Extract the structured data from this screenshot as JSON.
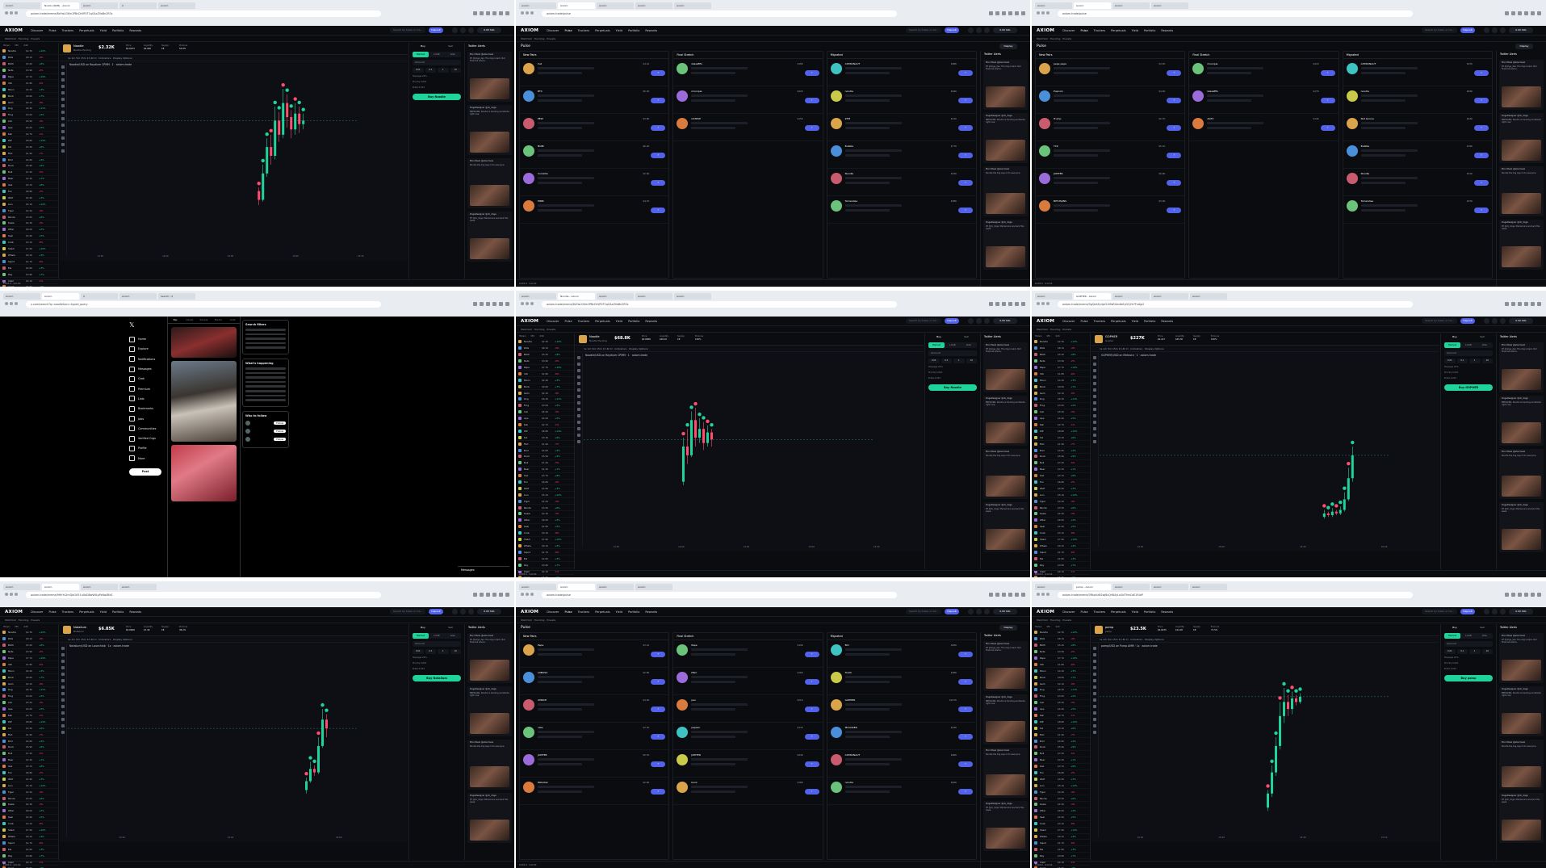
{
  "panels": [
    {
      "kind": "trade",
      "tabs": [
        "Axiom",
        "Nostlu (NUB) - Axiom",
        "Axiom",
        "X",
        "Axiom"
      ],
      "url": "axiom.trade/meme/8zYwLGKm1PBcDrVR5T1qGAxZVoBn2R3c",
      "nav": [
        "Discover",
        "Pulse",
        "Trackers",
        "Perpetuals",
        "Yield",
        "Portfolio",
        "Rewards"
      ],
      "coin": {
        "name": "Noodle",
        "sub": "Noodle the Dog",
        "price": "$2.32K"
      },
      "stats": [
        [
          "Price",
          "$0.0233"
        ],
        [
          "Liquidity",
          "$9.92K"
        ],
        [
          "Supply",
          "1B"
        ],
        [
          "B.Curve",
          "54.9%"
        ]
      ],
      "chart_title": "Noodle/USD on Raydium CPMM · 1 · axiom.trade",
      "times": [
        "13:30",
        "14:00",
        "14:30",
        "15:00",
        "15:30"
      ],
      "buy_label": "Buy Noodle",
      "footer": {
        "sol": "$158.9",
        "btc": "$113K"
      }
    },
    {
      "kind": "pulse",
      "tabs": [
        "Axiom",
        "Axiom",
        "Axiom",
        "Axiom",
        "Axiom"
      ],
      "url": "axiom.trade/pulse",
      "nav": [
        "Discover",
        "Pulse",
        "Trackers",
        "Perpetuals",
        "Yield",
        "Portfolio",
        "Rewards"
      ],
      "columns": [
        "New Pairs",
        "Final Stretch",
        "Migrated"
      ],
      "cards": [
        [
          [
            "Cat",
            "$4.1K"
          ],
          [
            "BTC",
            "$5.3K"
          ],
          [
            "PEW",
            "$3.8K"
          ],
          [
            "NOBI",
            "$6.2K"
          ],
          [
            "Coinzilla",
            "$2.9K"
          ],
          [
            "MNM",
            "$4.7K"
          ]
        ],
        [
          [
            "GlassEEs",
            "$18K"
          ],
          [
            "moonpie",
            "$22K"
          ],
          [
            "CATPUP",
            "$15K"
          ],
          [
            "",
            ""
          ],
          [
            "",
            ""
          ],
          [
            "",
            ""
          ]
        ],
        [
          [
            "ASTRONAUT",
            "$98K"
          ],
          [
            "noodle",
            "$64K"
          ],
          [
            "ZTM",
            "$41K"
          ],
          [
            "Bubble",
            "$77K"
          ],
          [
            "Noodle",
            "$52K"
          ],
          [
            "Tamandee",
            "$38K"
          ]
        ]
      ],
      "footer": {
        "sol": "$158.9",
        "btc": "$113K"
      }
    },
    {
      "kind": "pulse",
      "tabs": [
        "Axiom",
        "Axiom",
        "Axiom",
        "Axiom"
      ],
      "url": "axiom.trade/pulse",
      "nav": [
        "Discover",
        "Pulse",
        "Trackers",
        "Perpetuals",
        "Yield",
        "Portfolio",
        "Rewards"
      ],
      "columns": [
        "New Pairs",
        "Final Stretch",
        "Migrated"
      ],
      "cards": [
        [
          [
            "pepe pepe",
            "$3.2K"
          ],
          [
            "Pupcoin",
            "$4.4K"
          ],
          [
            "Trump",
            "$2.7K"
          ],
          [
            "Tint",
            "$5.1K"
          ],
          [
            "JUPITER",
            "$6.6K"
          ],
          [
            "BITCHAINS",
            "$3.9K"
          ]
        ],
        [
          [
            "moonpie",
            "$21K"
          ],
          [
            "GlassEEs",
            "$17K"
          ],
          [
            "AGTV",
            "$14K"
          ],
          [
            "",
            ""
          ],
          [
            "",
            ""
          ],
          [
            "",
            ""
          ]
        ],
        [
          [
            "ASTRONAUT",
            "$97K"
          ],
          [
            "noodle",
            "$63K"
          ],
          [
            "Not Gonna",
            "$44K"
          ],
          [
            "Bubble",
            "$76K"
          ],
          [
            "Noodle",
            "$51K"
          ],
          [
            "Tamandee",
            "$37K"
          ]
        ]
      ],
      "footer": {
        "sol": "$158.9",
        "btc": "$113K"
      }
    },
    {
      "kind": "x",
      "tabs": [
        "Axiom",
        "Axiom",
        "X",
        "Axiom",
        "Search / X"
      ],
      "url": "x.com/search?q=noodle&src=typed_query",
      "xnav": [
        "Home",
        "Explore",
        "Notifications",
        "Messages",
        "Grok",
        "Premium",
        "Lists",
        "Bookmarks",
        "Jobs",
        "Communities",
        "Verified Orgs",
        "Profile",
        "More"
      ],
      "post_label": "Post",
      "feed_tabs": [
        "Top",
        "Latest",
        "People",
        "Media",
        "Lists"
      ],
      "right": {
        "filters": "Search filters",
        "happening": "What's happening",
        "follow": "Who to follow",
        "follow_btn": "Follow"
      },
      "messages": "Messages"
    },
    {
      "kind": "trade",
      "tabs": [
        "Axiom",
        "Noodle - Axiom",
        "Axiom",
        "Axiom",
        "Axiom"
      ],
      "url": "axiom.trade/meme/8zYwLGKm1PBcDrVR5T1qGAxZVoBn2R3c",
      "nav": [
        "Discover",
        "Pulse",
        "Trackers",
        "Perpetuals",
        "Yield",
        "Portfolio",
        "Rewards"
      ],
      "coin": {
        "name": "Noodle",
        "sub": "Noodle the Dog",
        "price": "$68.8K"
      },
      "stats": [
        [
          "Price",
          "$0.0688"
        ],
        [
          "Liquidity",
          "$28.1K"
        ],
        [
          "Supply",
          "1B"
        ],
        [
          "B.Curve",
          "100%"
        ]
      ],
      "chart_title": "Noodle/USD on Raydium CPMM · 1 · axiom.trade",
      "times": [
        "13:30",
        "14:00",
        "14:30",
        "15:00",
        "15:30"
      ],
      "buy_label": "Buy Noodle",
      "footer": {
        "sol": "$158.9",
        "btc": "$113K"
      }
    },
    {
      "kind": "trade",
      "tabs": [
        "Axiom",
        "GOPHER - Axiom",
        "Axiom",
        "Axiom",
        "Axiom"
      ],
      "url": "axiom.trade/meme/5gQkAXy4pCLN9sRUmdbEyGQ2h7FxAjp2",
      "nav": [
        "Discover",
        "Pulse",
        "Trackers",
        "Perpetuals",
        "Yield",
        "Portfolio",
        "Rewards"
      ],
      "coin": {
        "name": "GOPHER",
        "sub": "Gopher",
        "price": "$227K"
      },
      "stats": [
        [
          "Price",
          "$0.227"
        ],
        [
          "Liquidity",
          "$45.3K"
        ],
        [
          "Supply",
          "1B"
        ],
        [
          "B.Curve",
          "100%"
        ]
      ],
      "chart_title": "GOPHER/USD on Meteora · 1 · axiom.trade",
      "times": [
        "14:30",
        "15:00",
        "15:30",
        "16:00"
      ],
      "buy_label": "Buy GOPHER",
      "footer": {
        "sol": "$158.9",
        "btc": "$113K"
      }
    },
    {
      "kind": "trade",
      "tabs": [
        "Axiom",
        "Axiom",
        "Axiom",
        "Axiom"
      ],
      "url": "axiom.trade/meme/9HhYv2mQbGkTr1uXoD8wWfLpPzNq4RkS",
      "nav": [
        "Discover",
        "Pulse",
        "Trackers",
        "Perpetuals",
        "Yield",
        "Portfolio",
        "Rewards"
      ],
      "coin": {
        "name": "Notalium",
        "sub": "Notalium",
        "price": "$6.85K"
      },
      "stats": [
        [
          "Price",
          "$0.0068"
        ],
        [
          "Liquidity",
          "$7.4K"
        ],
        [
          "Supply",
          "1B"
        ],
        [
          "B.Curve",
          "38.2%"
        ]
      ],
      "chart_title": "Notalium/USD on Launchlab · 1s · axiom.trade",
      "times": [
        "15:20",
        "15:40",
        "16:00"
      ],
      "buy_label": "Buy Notalium",
      "footer": {
        "sol": "$158.9",
        "btc": "$113K"
      }
    },
    {
      "kind": "pulse",
      "tabs": [
        "Axiom",
        "Axiom",
        "Axiom",
        "Axiom"
      ],
      "url": "axiom.trade/pulse",
      "nav": [
        "Discover",
        "Pulse",
        "Trackers",
        "Perpetuals",
        "Yield",
        "Portfolio",
        "Rewards"
      ],
      "columns": [
        "New Pairs",
        "Final Stretch",
        "Migrated"
      ],
      "cards": [
        [
          [
            "Pepe",
            "$3.1K"
          ],
          [
            "LOBUSU",
            "$2.8K"
          ],
          [
            "UPRICE",
            "$4.0K"
          ],
          [
            "cate",
            "$3.3K"
          ],
          [
            "JUPITER",
            "$5.7K"
          ],
          [
            "Palladier",
            "$2.6K"
          ]
        ],
        [
          [
            "Pepe",
            "$19K"
          ],
          [
            "MGC",
            "$16K"
          ],
          [
            "pen",
            "$21K"
          ],
          [
            "pepsim",
            "$13K"
          ],
          [
            "JUPITER",
            "$24K"
          ],
          [
            "bunz",
            "$18K"
          ]
        ],
        [
          [
            "BCI",
            "$82K"
          ],
          [
            "Tooth",
            "$58K"
          ],
          [
            "GOPHER",
            "$227K"
          ],
          [
            "MCCOKER",
            "$44K"
          ],
          [
            "ASTRONAUT",
            "$96K"
          ],
          [
            "noodle",
            "$62K"
          ]
        ]
      ],
      "footer": {
        "sol": "$158.9",
        "btc": "$113K"
      }
    },
    {
      "kind": "trade",
      "tabs": [
        "Axiom",
        "pamp - Axiom",
        "Axiom",
        "Axiom",
        "Axiom"
      ],
      "url": "axiom.trade/meme/3RkpVzN2wJ8sQhB4yLxGdT9mCaE1fUoP",
      "nav": [
        "Discover",
        "Pulse",
        "Trackers",
        "Perpetuals",
        "Yield",
        "Portfolio",
        "Rewards"
      ],
      "coin": {
        "name": "pamp",
        "sub": "pamp",
        "price": "$23.5K"
      },
      "stats": [
        [
          "Price",
          "$0.0235"
        ],
        [
          "Liquidity",
          "$14.2K"
        ],
        [
          "Supply",
          "1B"
        ],
        [
          "B.Curve",
          "71.5%"
        ]
      ],
      "chart_title": "pamp/USD on Pump AMM · 1s · axiom.trade",
      "times": [
        "15:20",
        "15:30",
        "15:40",
        "15:50"
      ],
      "buy_label": "Buy pamp",
      "footer": {
        "sol": "$158.9",
        "btc": "$113K"
      }
    }
  ],
  "watchlist": {
    "head": [
      "Token",
      "MC",
      "24h"
    ],
    "rows": [
      [
        "Noodle",
        "$2.3K",
        "+12%"
      ],
      [
        "RUG",
        "$8.1K",
        "-4%"
      ],
      [
        "BAYC",
        "$5.2K",
        "+8%"
      ],
      [
        "Nuts",
        "$3.9K",
        "-2%"
      ],
      [
        "Pepe",
        "$7.7K",
        "+19%"
      ],
      [
        "Yeti",
        "$1.8K",
        "-6%"
      ],
      [
        "Moon",
        "$4.4K",
        "+3%"
      ],
      [
        "Bonk",
        "$9.6K",
        "+7%"
      ],
      [
        "Gem",
        "$2.1K",
        "-9%"
      ],
      [
        "Dog",
        "$6.3K",
        "+11%"
      ],
      [
        "Frog",
        "$3.0K",
        "+2%"
      ],
      [
        "Cat",
        "$5.5K",
        "-3%"
      ],
      [
        "Ape",
        "$4.0K",
        "+5%"
      ],
      [
        "Kek",
        "$2.7K",
        "-1%"
      ],
      [
        "Wif",
        "$8.8K",
        "+14%"
      ],
      [
        "Sol",
        "$3.3K",
        "+6%"
      ],
      [
        "Fish",
        "$1.9K",
        "-7%"
      ],
      [
        "Bird",
        "$4.6K",
        "+4%"
      ],
      [
        "Duck",
        "$5.9K",
        "+9%"
      ],
      [
        "Bull",
        "$7.2K",
        "-5%"
      ],
      [
        "Bear",
        "$2.4K",
        "+1%"
      ],
      [
        "Owl",
        "$3.7K",
        "+8%"
      ],
      [
        "Fox",
        "$6.8K",
        "-2%"
      ],
      [
        "Wolf",
        "$4.9K",
        "+3%"
      ],
      [
        "Lion",
        "$5.1K",
        "+12%"
      ],
      [
        "Tiger",
        "$2.2K",
        "-4%"
      ],
      [
        "Panda",
        "$3.5K",
        "+6%"
      ],
      [
        "Koala",
        "$4.3K",
        "-3%"
      ],
      [
        "Otter",
        "$6.0K",
        "+2%"
      ],
      [
        "Seal",
        "$2.9K",
        "+5%"
      ],
      [
        "Crab",
        "$3.1K",
        "-8%"
      ],
      [
        "Shark",
        "$7.9K",
        "+10%"
      ],
      [
        "Whale",
        "$9.1K",
        "+4%"
      ],
      [
        "Squid",
        "$1.7K",
        "-6%"
      ],
      [
        "Eel",
        "$2.6K",
        "+3%"
      ],
      [
        "Ray",
        "$3.8K",
        "+7%"
      ],
      [
        "Clam",
        "$4.1K",
        "-1%"
      ],
      [
        "Coral",
        "$5.6K",
        "+9%"
      ],
      [
        "Reef",
        "$2.3K",
        "-2%"
      ],
      [
        "Tide",
        "$3.4K",
        "+4%"
      ],
      [
        "Wave",
        "$6.7K",
        "+13%"
      ]
    ]
  },
  "order": {
    "tabs": [
      "Buy",
      "Sell"
    ],
    "seg": [
      "Market",
      "Limit",
      "Adv."
    ],
    "amount": "Amount",
    "presets": [
      "0.01",
      "0.1",
      "1",
      "10"
    ],
    "lines": [
      "Slippage 20%",
      "Priority 0.001",
      "Bribe 0.001"
    ]
  },
  "twitter": {
    "head": "Twitter Alerts",
    "cards": [
      {
        "user": "Elon Musk @elonmusk",
        "text": "RT @doge_dev: The dog is back. Not financial advice."
      },
      {
        "user": "DogeDesigner @cb_doge",
        "text": "BREAKING: Noodle is trending worldwide right now."
      },
      {
        "user": "Elon Musk @elonmusk",
        "text": "Noodle the dog says hi to everyone."
      },
      {
        "user": "DogeDesigner @cb_doge",
        "text": "RT @cb_doge: Memecoins are back this week."
      }
    ]
  },
  "subbar": "Watchlist · Trending · Presets",
  "display_label": "Display",
  "pulse_title": "Pulse",
  "search_placeholder": "Search by token or CA...",
  "deposit_label": "Deposit",
  "wallet_label": "0.00 SOL",
  "chart_toolbar": "1s  1m  5m  15m  1h  4h  D  · Indicators · Display Options",
  "chart_data": [
    {
      "type": "candlestick",
      "panel": 0,
      "candles": [
        [
          0.3,
          0.25,
          0.32,
          0.22
        ],
        [
          0.25,
          0.4,
          0.45,
          0.24
        ],
        [
          0.4,
          0.55,
          0.6,
          0.38
        ],
        [
          0.55,
          0.5,
          0.62,
          0.45
        ],
        [
          0.5,
          0.7,
          0.78,
          0.48
        ],
        [
          0.7,
          0.62,
          0.75,
          0.58
        ],
        [
          0.62,
          0.8,
          0.88,
          0.6
        ],
        [
          0.8,
          0.72,
          0.85,
          0.66
        ],
        [
          0.72,
          0.65,
          0.76,
          0.6
        ],
        [
          0.65,
          0.74,
          0.8,
          0.62
        ],
        [
          0.74,
          0.68,
          0.78,
          0.63
        ],
        [
          0.68,
          0.7,
          0.74,
          0.65
        ]
      ],
      "start": 0.82
    },
    {
      "type": "candlestick",
      "panel": 4,
      "candles": [
        [
          0.3,
          0.5,
          0.55,
          0.28
        ],
        [
          0.5,
          0.45,
          0.6,
          0.4
        ],
        [
          0.45,
          0.65,
          0.7,
          0.44
        ],
        [
          0.65,
          0.55,
          0.72,
          0.5
        ],
        [
          0.55,
          0.6,
          0.66,
          0.52
        ],
        [
          0.6,
          0.52,
          0.64,
          0.48
        ],
        [
          0.52,
          0.58,
          0.62,
          0.5
        ],
        [
          0.58,
          0.54,
          0.6,
          0.5
        ]
      ],
      "start": 0.45
    },
    {
      "type": "candlestick",
      "panel": 5,
      "candles": [
        [
          0.1,
          0.12,
          0.14,
          0.09
        ],
        [
          0.12,
          0.11,
          0.13,
          0.1
        ],
        [
          0.11,
          0.13,
          0.15,
          0.1
        ],
        [
          0.13,
          0.12,
          0.14,
          0.11
        ],
        [
          0.12,
          0.14,
          0.16,
          0.11
        ],
        [
          0.14,
          0.2,
          0.24,
          0.13
        ],
        [
          0.2,
          0.32,
          0.38,
          0.19
        ],
        [
          0.32,
          0.45,
          0.5,
          0.3
        ]
      ],
      "start": 0.88
    },
    {
      "type": "candlestick",
      "panel": 6,
      "candles": [
        [
          0.2,
          0.25,
          0.27,
          0.18
        ],
        [
          0.25,
          0.32,
          0.36,
          0.24
        ],
        [
          0.32,
          0.3,
          0.34,
          0.28
        ],
        [
          0.3,
          0.45,
          0.5,
          0.29
        ],
        [
          0.45,
          0.6,
          0.66,
          0.44
        ],
        [
          0.6,
          0.55,
          0.63,
          0.5
        ]
      ],
      "start": 0.9
    },
    {
      "type": "candlestick",
      "panel": 8,
      "candles": [
        [
          0.1,
          0.18,
          0.2,
          0.08
        ],
        [
          0.18,
          0.3,
          0.34,
          0.16
        ],
        [
          0.3,
          0.45,
          0.5,
          0.28
        ],
        [
          0.45,
          0.62,
          0.7,
          0.43
        ],
        [
          0.62,
          0.7,
          0.78,
          0.58
        ],
        [
          0.7,
          0.66,
          0.74,
          0.62
        ],
        [
          0.66,
          0.72,
          0.76,
          0.63
        ],
        [
          0.72,
          0.7,
          0.74,
          0.68
        ],
        [
          0.7,
          0.73,
          0.75,
          0.69
        ]
      ],
      "start": 0.7
    }
  ]
}
